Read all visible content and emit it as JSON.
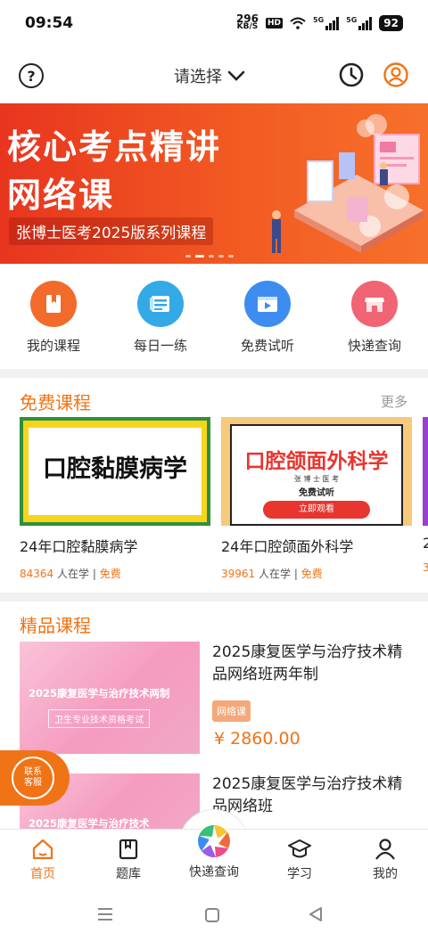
{
  "status_bar": {
    "time": "09:54",
    "net_speed_value": "296",
    "net_speed_unit": "KB/S",
    "hd_label": "HD",
    "signal1_label": "5G",
    "signal2_label": "5G",
    "battery": "92"
  },
  "top_nav": {
    "help_symbol": "?",
    "selector_label": "请选择"
  },
  "banner": {
    "title_line1": "核心考点精讲",
    "title_line2": "网络课",
    "subtitle": "张博士医考2025版系列课程",
    "page_count": 5,
    "active_page": 1
  },
  "quick_links": [
    {
      "label": "我的课程",
      "icon": "book-icon",
      "color": "#f26b2a"
    },
    {
      "label": "每日一练",
      "icon": "practice-icon",
      "color": "#33a9e6"
    },
    {
      "label": "免费试听",
      "icon": "play-video-icon",
      "color": "#3d8df0"
    },
    {
      "label": "快递查询",
      "icon": "shop-icon",
      "color": "#f06474"
    }
  ],
  "free_courses": {
    "title": "免费课程",
    "more": "更多",
    "items": [
      {
        "thumb_text": "口腔黏膜病学",
        "title": "24年口腔黏膜病学",
        "learners": "84364",
        "learners_suffix": " 人在学 | ",
        "price": "免费"
      },
      {
        "thumb_text": "口腔颌面外科学",
        "thumb_sub1": "张 博 士 医 考",
        "thumb_sub2": "免费试听",
        "thumb_btn": "立即观看",
        "title": "24年口腔颌面外科学",
        "learners": "39961",
        "learners_suffix": " 人在学 | ",
        "price": "免费"
      },
      {
        "title": "2",
        "learners": "3"
      }
    ]
  },
  "premium_courses": {
    "title": "精品课程",
    "items": [
      {
        "thumb_title": "2025康复医学与治疗技术两制",
        "thumb_sub": "卫生专业技术资格考试",
        "title": "2025康复医学与治疗技术精品网络班两年制",
        "tag": "网络课",
        "price": "¥ 2860.00"
      },
      {
        "thumb_title": "2025康复医学与治疗技术",
        "title": "2025康复医学与治疗技术精品网络班"
      }
    ]
  },
  "contact": {
    "line1": "联系",
    "line2": "客服"
  },
  "tabbar": {
    "active": "首页",
    "tabs": [
      {
        "label": "首页",
        "icon": "home-icon"
      },
      {
        "label": "题库",
        "icon": "question-bank-icon"
      },
      {
        "label": "快递查询",
        "icon": "aperture-icon"
      },
      {
        "label": "学习",
        "icon": "graduation-cap-icon"
      },
      {
        "label": "我的",
        "icon": "person-icon"
      }
    ]
  },
  "colors": {
    "accent": "#f07316",
    "banner": "#e8351f"
  }
}
